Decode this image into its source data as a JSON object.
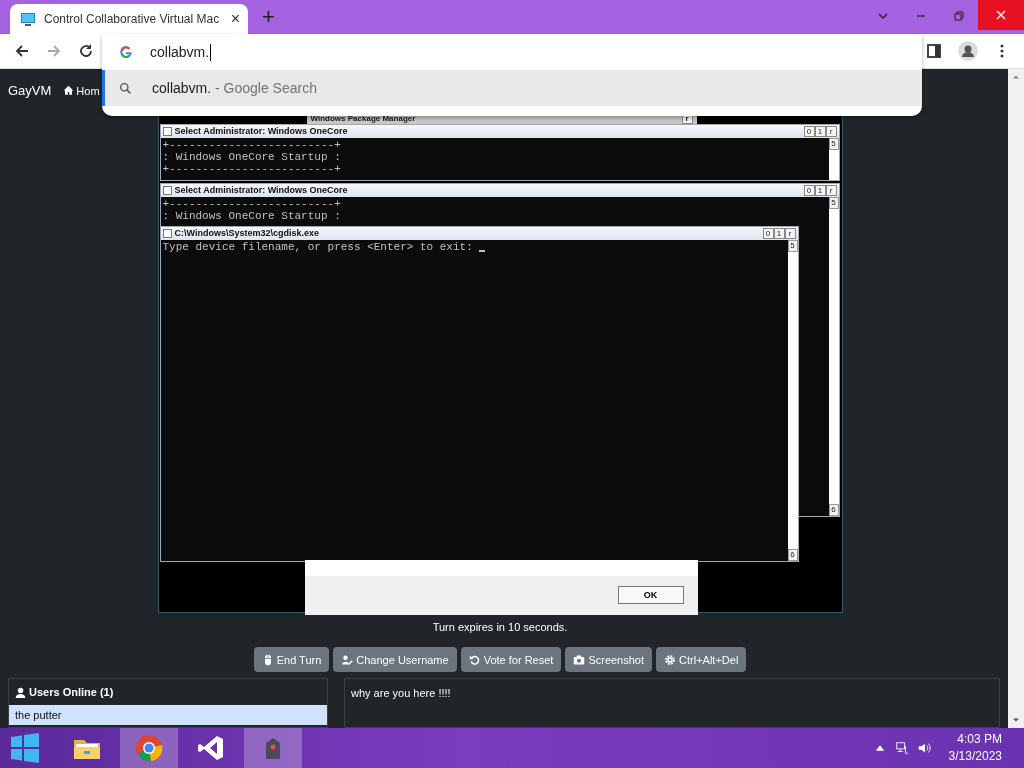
{
  "browser": {
    "tab": {
      "title": "Control Collaborative Virtual Mac",
      "close": "×"
    },
    "new_tab": "+",
    "address": {
      "value": "collabvm."
    },
    "suggestions": [
      {
        "query": "collabvm.",
        "hint": " - Google Search",
        "selected": true
      }
    ]
  },
  "site": {
    "brand": "GayVM",
    "nav": [
      {
        "label": "Hom"
      }
    ]
  },
  "vm": {
    "background_window": {
      "title": "Windows Package Manager",
      "button": "r"
    },
    "windows": [
      {
        "title": "Select Administrator:  Windows OneCore",
        "buttons": [
          "0",
          "1",
          "r"
        ],
        "scroll_up": "5",
        "cursor": false,
        "lines": [
          "+-------------------------+",
          ": Windows OneCore Startup :",
          "+-------------------------+"
        ]
      },
      {
        "title": "Select Administrator:  Windows OneCore",
        "buttons": [
          "0",
          "1",
          "r"
        ],
        "scroll_up": "5",
        "scroll_down": "6",
        "cursor": false,
        "lines": [
          "+-------------------------+",
          ": Windows OneCore Startup :"
        ]
      },
      {
        "title": "C:\\Windows\\System32\\cgdisk.exe",
        "buttons": [
          "0",
          "1",
          "r"
        ],
        "scroll_up": "5",
        "scroll_down": "6",
        "cursor": true,
        "lines": [
          "Type device filename, or press <Enter> to exit: "
        ]
      }
    ],
    "dialog": {
      "button": "OK"
    }
  },
  "turn_status": "Turn expires in 10 seconds.",
  "actions": [
    {
      "label": "End Turn"
    },
    {
      "label": "Change Username"
    },
    {
      "label": "Vote for Reset"
    },
    {
      "label": "Screenshot"
    },
    {
      "label": "Ctrl+Alt+Del"
    }
  ],
  "users": {
    "title": "Users Online (1)",
    "items": [
      {
        "name": "the putter"
      }
    ]
  },
  "chat": {
    "messages": [
      "why are you here !!!!"
    ]
  },
  "taskbar": {
    "apps": [
      {
        "selected": false
      },
      {
        "selected": true
      },
      {
        "selected": false
      },
      {
        "selected": true
      }
    ],
    "time": "4:03 PM",
    "date": "3/13/2023"
  }
}
